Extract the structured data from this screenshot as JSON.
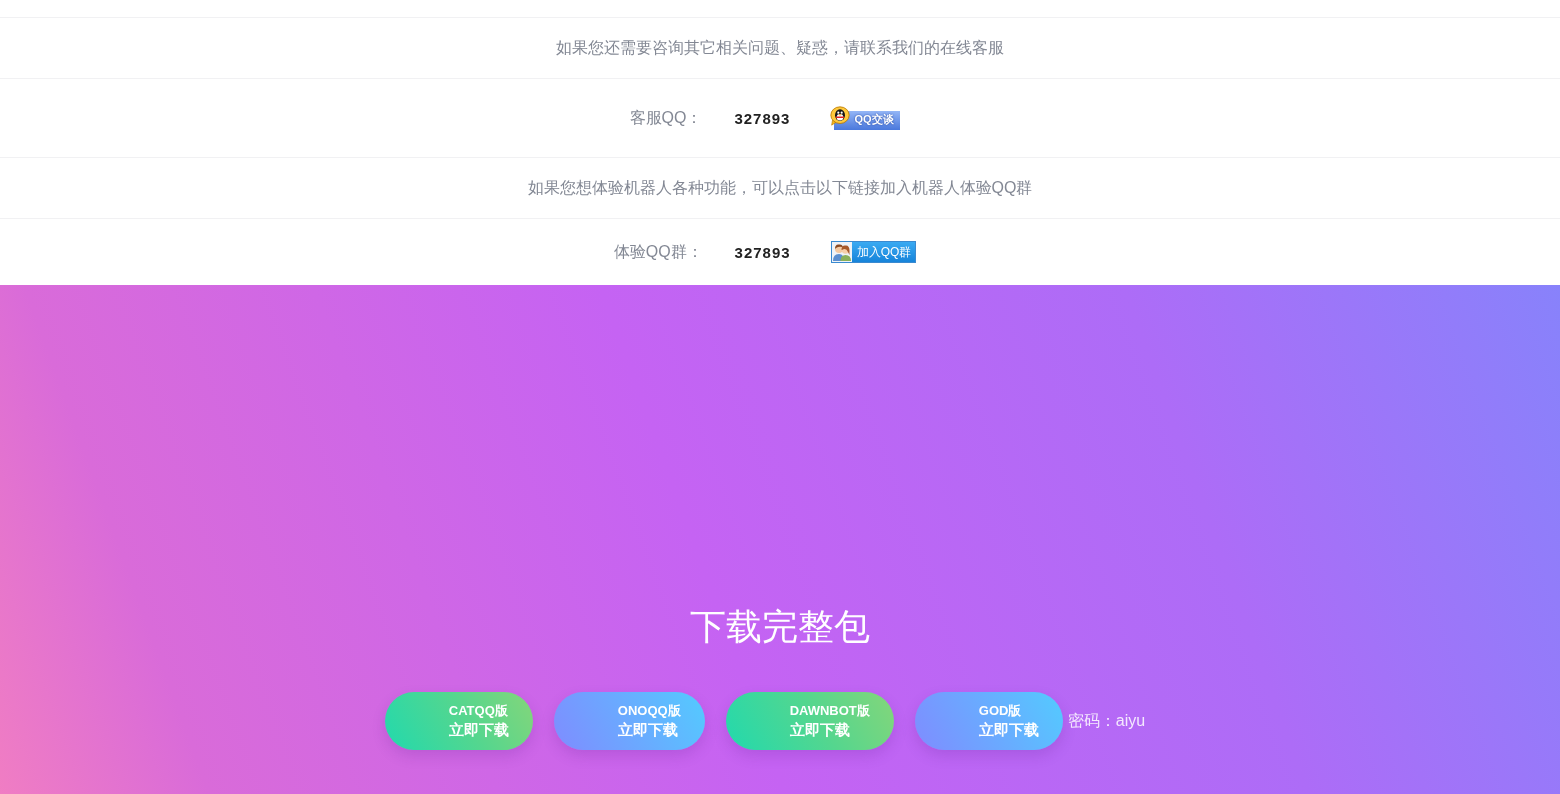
{
  "info_rows": [
    {
      "kind": "message",
      "text": "如果您还需要咨询其它相关问题、疑惑，请联系我们的在线客服"
    },
    {
      "kind": "contact",
      "label": "客服QQ：",
      "number": "327893",
      "link": {
        "kind": "chat",
        "text": "QQ交谈"
      }
    },
    {
      "kind": "message",
      "text": "如果您想体验机器人各种功能，可以点击以下链接加入机器人体验QQ群"
    },
    {
      "kind": "contact",
      "label": "体验QQ群：",
      "number": "327893",
      "link": {
        "kind": "group",
        "text": "加入QQ群"
      }
    }
  ],
  "download": {
    "title": "下载完整包",
    "buttons": [
      {
        "kind": "green",
        "name": "CATQQ版",
        "action": "立即下载"
      },
      {
        "kind": "blue",
        "name": "ONOQQ版",
        "action": "立即下载"
      },
      {
        "kind": "green",
        "name": "DAWNBOT版",
        "action": "立即下载"
      },
      {
        "kind": "blue",
        "name": "GOD版",
        "action": "立即下载"
      }
    ],
    "password": "密码：aiyu"
  }
}
